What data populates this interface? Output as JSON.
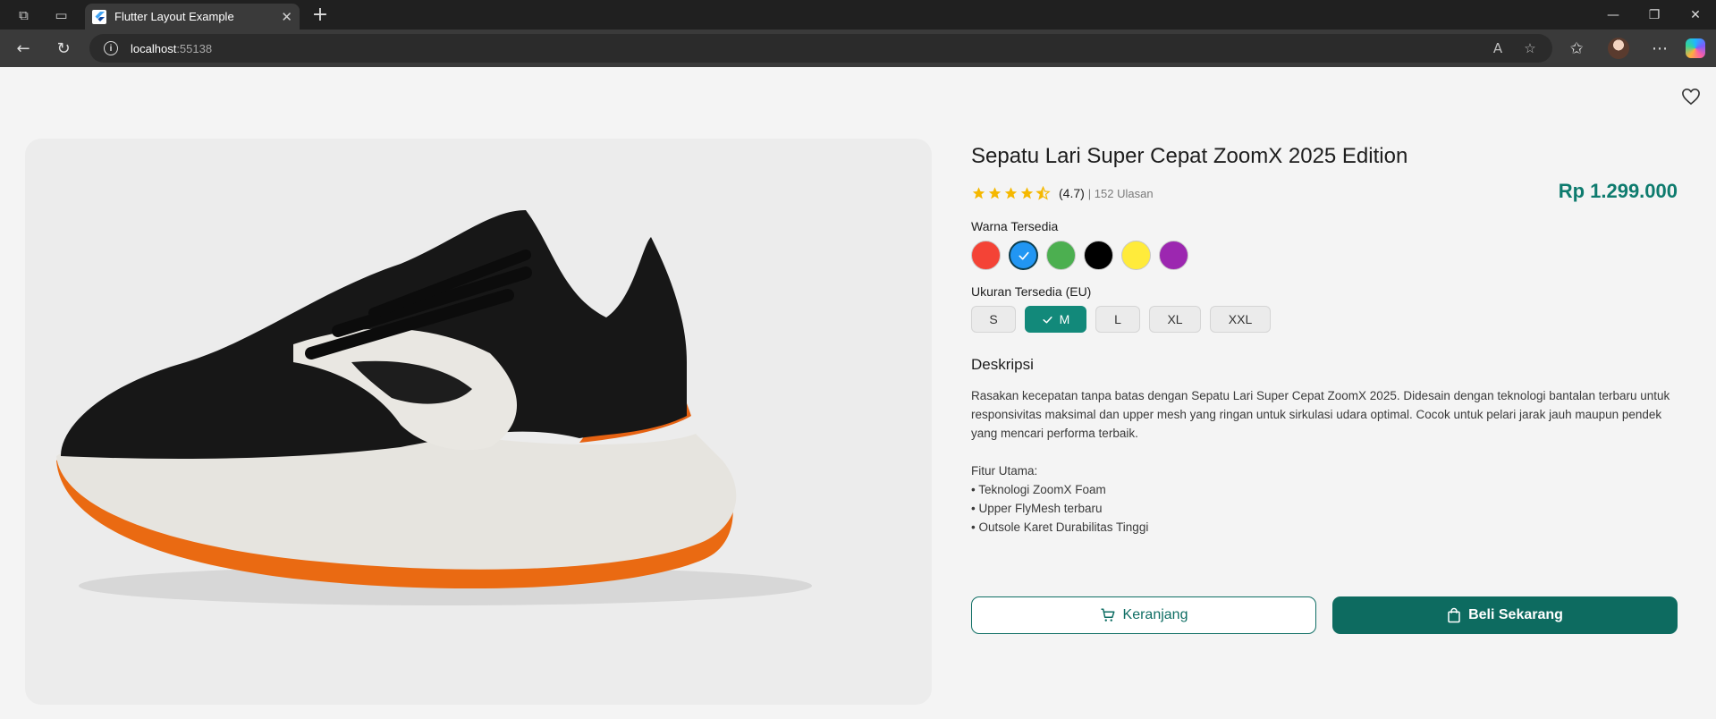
{
  "browser": {
    "tab_title": "Flutter Layout Example",
    "url_host": "localhost",
    "url_port": ":55138"
  },
  "product": {
    "title": "Sepatu Lari Super Cepat ZoomX 2025 Edition",
    "rating": "(4.7)",
    "rating_value": 4.7,
    "reviews": "| 152 Ulasan",
    "price": "Rp 1.299.000",
    "colors_label": "Warna Tersedia",
    "colors": [
      "#f44336",
      "#2196f3",
      "#4caf50",
      "#000000",
      "#ffeb3b",
      "#9c27b0"
    ],
    "selected_color_index": 1,
    "sizes_label": "Ukuran Tersedia (EU)",
    "sizes": [
      "S",
      "M",
      "L",
      "XL",
      "XXL"
    ],
    "selected_size": "M",
    "desc_title": "Deskripsi",
    "description": "Rasakan kecepatan tanpa batas dengan Sepatu Lari Super Cepat ZoomX 2025. Didesain dengan teknologi bantalan terbaru untuk responsivitas maksimal dan upper mesh yang ringan untuk sirkulasi udara optimal. Cocok untuk pelari jarak jauh maupun pendek yang mencari performa terbaik.",
    "features_title": "Fitur Utama:",
    "features": [
      "• Teknologi ZoomX Foam",
      "• Upper FlyMesh terbaru",
      "• Outsole Karet Durabilitas Tinggi"
    ],
    "cart_label": "Keranjang",
    "buy_label": "Beli Sekarang"
  },
  "colors": {
    "accent": "#0e7b6e",
    "star": "#f5b800"
  }
}
